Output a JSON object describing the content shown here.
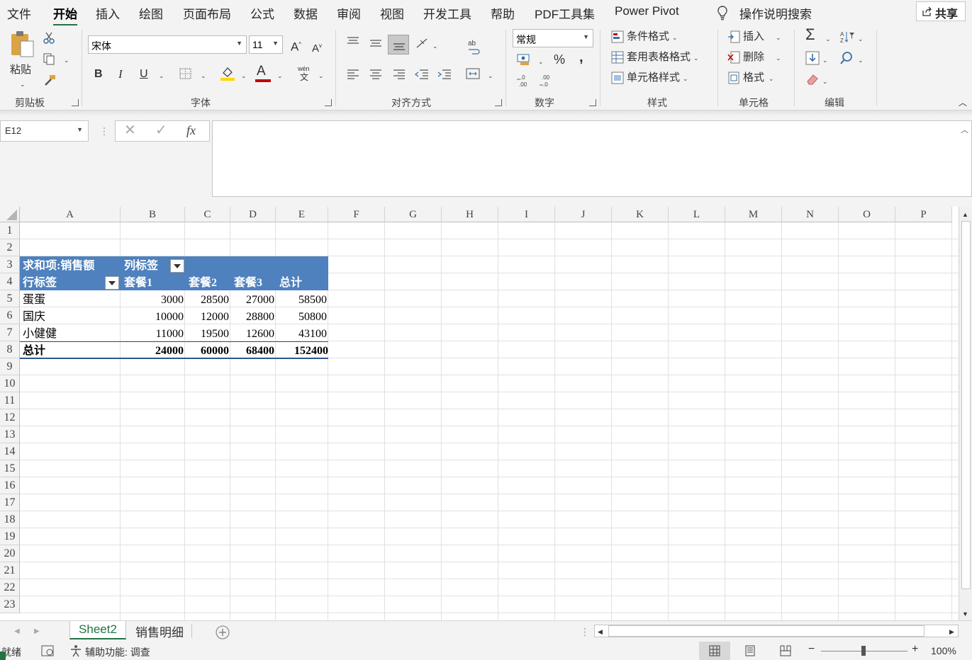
{
  "menu": {
    "tabs": [
      "文件",
      "开始",
      "插入",
      "绘图",
      "页面布局",
      "公式",
      "数据",
      "审阅",
      "视图",
      "开发工具",
      "帮助",
      "PDF工具集",
      "Power Pivot"
    ],
    "search": "操作说明搜索",
    "share": "共享"
  },
  "ribbon": {
    "clipboard": {
      "label": "剪贴板",
      "paste": "粘贴"
    },
    "font": {
      "label": "字体",
      "name": "宋体",
      "size": "11",
      "bold": "B",
      "italic": "I",
      "underline": "U",
      "grow": "A",
      "shrink": "A",
      "color_a": "A",
      "phonetic_top": "wén",
      "phonetic_bottom": "文"
    },
    "align": {
      "label": "对齐方式"
    },
    "number": {
      "label": "数字",
      "format": "常规",
      "percent": "%",
      "comma": ","
    },
    "styles": {
      "label": "样式",
      "conditional": "条件格式",
      "table": "套用表格格式",
      "cell": "单元格样式"
    },
    "cells": {
      "label": "单元格",
      "insert": "插入",
      "delete": "删除",
      "format": "格式"
    },
    "edit": {
      "label": "编辑"
    }
  },
  "formula_bar": {
    "name_box": "E12",
    "fx": "fx",
    "content": ""
  },
  "columns": [
    "A",
    "B",
    "C",
    "D",
    "E",
    "F",
    "G",
    "H",
    "I",
    "J",
    "K",
    "L",
    "M",
    "N",
    "O",
    "P"
  ],
  "rows": [
    "1",
    "2",
    "3",
    "4",
    "5",
    "6",
    "7",
    "8",
    "9",
    "10",
    "11",
    "12",
    "13",
    "14",
    "15",
    "16",
    "17",
    "18",
    "19",
    "20",
    "21",
    "22",
    "23"
  ],
  "pivot": {
    "value_field": "求和项:销售额",
    "col_label": "列标签",
    "row_label": "行标签",
    "headers": [
      "套餐1",
      "套餐2",
      "套餐3",
      "总计"
    ],
    "rows": [
      {
        "name": "蛋蛋",
        "values": [
          "3000",
          "28500",
          "27000",
          "58500"
        ]
      },
      {
        "name": "国庆",
        "values": [
          "10000",
          "12000",
          "28800",
          "50800"
        ]
      },
      {
        "name": "小健健",
        "values": [
          "11000",
          "19500",
          "12600",
          "43100"
        ]
      }
    ],
    "total": {
      "name": "总计",
      "values": [
        "24000",
        "60000",
        "68400",
        "152400"
      ]
    }
  },
  "sheets": [
    "Sheet2",
    "销售明细"
  ],
  "status": {
    "ready": "就绪",
    "accessibility": "辅助功能: 调查",
    "zoom": "100%"
  },
  "colors": {
    "accent": "#217346",
    "pivot_header": "#4e81bd",
    "pivot_border": "#2f5496"
  }
}
